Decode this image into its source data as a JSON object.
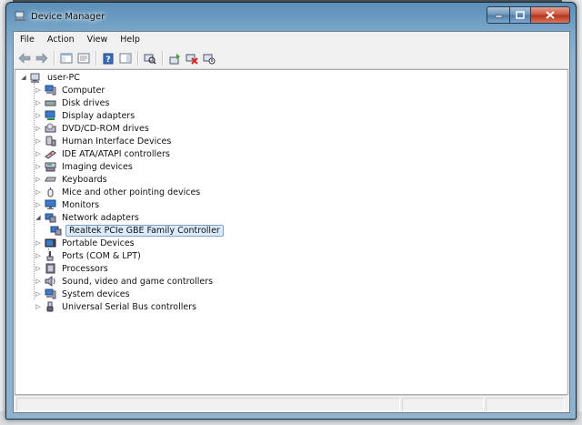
{
  "window": {
    "title": "Device Manager"
  },
  "menu": [
    "File",
    "Action",
    "View",
    "Help"
  ],
  "toolbar": {
    "buttons": [
      "back",
      "forward",
      "show-hide-console-tree",
      "properties",
      "help",
      "action-pane",
      "scan-for-hardware-changes",
      "update-driver",
      "uninstall",
      "disable"
    ]
  },
  "tree": {
    "root": "user-PC",
    "categories": [
      {
        "label": "Computer",
        "icon": "computer-icon",
        "expanded": false
      },
      {
        "label": "Disk drives",
        "icon": "disk-drive-icon",
        "expanded": false
      },
      {
        "label": "Display adapters",
        "icon": "display-adapter-icon",
        "expanded": false
      },
      {
        "label": "DVD/CD-ROM drives",
        "icon": "dvd-drive-icon",
        "expanded": false
      },
      {
        "label": "Human Interface Devices",
        "icon": "hid-icon",
        "expanded": false
      },
      {
        "label": "IDE ATA/ATAPI controllers",
        "icon": "ide-controller-icon",
        "expanded": false
      },
      {
        "label": "Imaging devices",
        "icon": "imaging-device-icon",
        "expanded": false
      },
      {
        "label": "Keyboards",
        "icon": "keyboard-icon",
        "expanded": false
      },
      {
        "label": "Mice and other pointing devices",
        "icon": "mouse-icon",
        "expanded": false
      },
      {
        "label": "Monitors",
        "icon": "monitor-icon",
        "expanded": false
      },
      {
        "label": "Network adapters",
        "icon": "network-adapter-icon",
        "expanded": true,
        "children": [
          {
            "label": "Realtek PCIe GBE Family Controller",
            "icon": "network-card-icon",
            "selected": true
          }
        ]
      },
      {
        "label": "Portable Devices",
        "icon": "portable-device-icon",
        "expanded": false
      },
      {
        "label": "Ports (COM & LPT)",
        "icon": "port-icon",
        "expanded": false
      },
      {
        "label": "Processors",
        "icon": "processor-icon",
        "expanded": false
      },
      {
        "label": "Sound, video and game controllers",
        "icon": "speaker-icon",
        "expanded": false
      },
      {
        "label": "System devices",
        "icon": "system-device-icon",
        "expanded": false
      },
      {
        "label": "Universal Serial Bus controllers",
        "icon": "usb-icon",
        "expanded": false
      }
    ]
  },
  "colors": {
    "accent": "#6c9cc2",
    "selection": "#dcebfc",
    "selection_border": "#7da2ce",
    "close_button": "#c8513a"
  }
}
